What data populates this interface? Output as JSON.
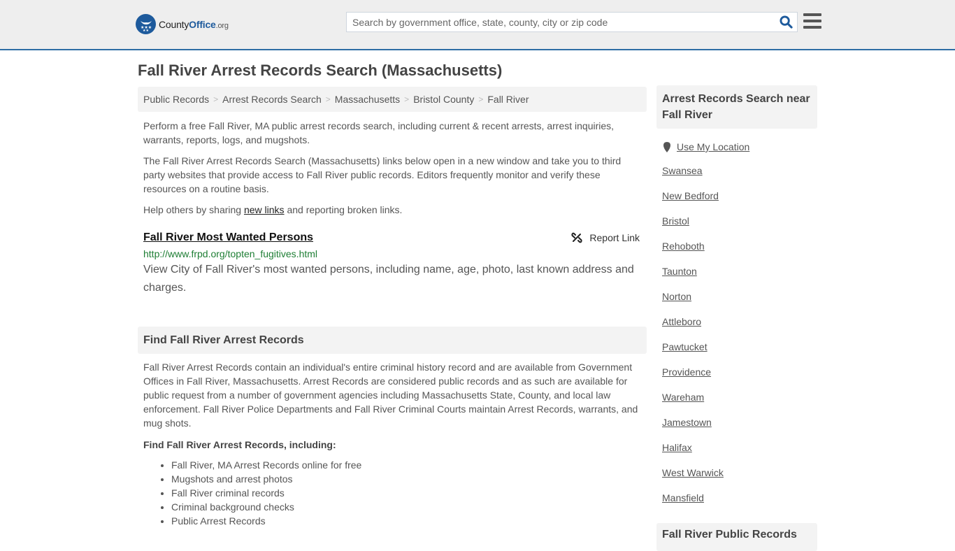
{
  "header": {
    "logo": {
      "main": "County",
      "accent": "Office",
      "tld": ".org",
      "icon": "eagle-stars-badge-icon"
    },
    "search": {
      "placeholder": "Search by government office, state, county, city or zip code",
      "value": ""
    },
    "colors": {
      "brand": "#1d5a9c",
      "header_bg": "#eeeeee",
      "header_border": "#2e6da4"
    }
  },
  "page": {
    "title": "Fall River Arrest Records Search (Massachusetts)"
  },
  "breadcrumb": [
    {
      "label": "Public Records"
    },
    {
      "label": "Arrest Records Search"
    },
    {
      "label": "Massachusetts"
    },
    {
      "label": "Bristol County"
    },
    {
      "label": "Fall River"
    }
  ],
  "breadcrumb_separator": ">",
  "intro": {
    "p1": "Perform a free Fall River, MA public arrest records search, including current & recent arrests, arrest inquiries, warrants, reports, logs, and mugshots.",
    "p2": "The Fall River Arrest Records Search (Massachusetts) links below open in a new window and take you to third party websites that provide access to Fall River public records. Editors frequently monitor and verify these resources on a routine basis.",
    "p3_before": "Help others by sharing ",
    "p3_link": "new links",
    "p3_after": " and reporting broken links."
  },
  "links": [
    {
      "title": "Fall River Most Wanted Persons",
      "url": "http://www.frpd.org/topten_fugitives.html",
      "description": "View City of Fall River's most wanted persons, including name, age, photo, last known address and charges.",
      "report_label": "Report Link"
    }
  ],
  "find_section": {
    "heading": "Find Fall River Arrest Records",
    "body": "Fall River Arrest Records contain an individual's entire criminal history record and are available from Government Offices in Fall River, Massachusetts. Arrest Records are considered public records and as such are available for public request from a number of government agencies including Massachusetts State, County, and local law enforcement. Fall River Police Departments and Fall River Criminal Courts maintain Arrest Records, warrants, and mug shots.",
    "subheading": "Find Fall River Arrest Records, including:",
    "bullets": [
      "Fall River, MA Arrest Records online for free",
      "Mugshots and arrest photos",
      "Fall River criminal records",
      "Criminal background checks",
      "Public Arrest Records"
    ]
  },
  "sidebar": {
    "heading": "Arrest Records Search near Fall River",
    "use_location": "Use My Location",
    "nearby": [
      "Swansea",
      "New Bedford",
      "Bristol",
      "Rehoboth",
      "Taunton",
      "Norton",
      "Attleboro",
      "Pawtucket",
      "Providence",
      "Wareham",
      "Jamestown",
      "Halifax",
      "West Warwick",
      "Mansfield"
    ],
    "heading2": "Fall River Public Records"
  }
}
